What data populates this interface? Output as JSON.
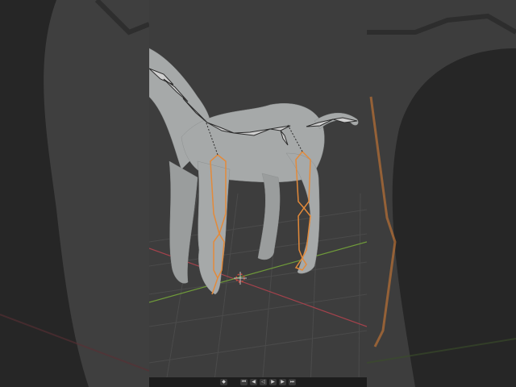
{
  "viewport": {
    "background": "#3d3d3d",
    "grid_color": "#4a4a4a",
    "x_axis_color": "#a4424c",
    "y_axis_color": "#6f9a3a"
  },
  "armature": {
    "selected_bone_color": "#e38a3a",
    "unselected_bone_color": "#2b2b2b"
  },
  "timeline": {
    "buttons": [
      {
        "icon": "keyframe-icon",
        "glyph": "◆"
      },
      {
        "icon": "jump-start-icon",
        "glyph": "⏮"
      },
      {
        "icon": "prev-keyframe-icon",
        "glyph": "◀"
      },
      {
        "icon": "play-reverse-icon",
        "glyph": "◁"
      },
      {
        "icon": "play-icon",
        "glyph": "▶"
      },
      {
        "icon": "next-keyframe-icon",
        "glyph": "▶"
      },
      {
        "icon": "jump-end-icon",
        "glyph": "⏭"
      }
    ]
  }
}
